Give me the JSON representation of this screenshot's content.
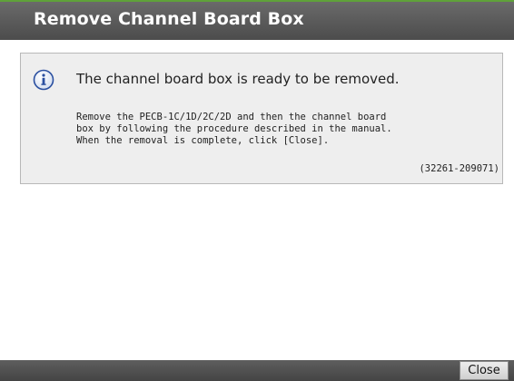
{
  "dialog": {
    "title": "Remove Channel Board Box",
    "message": {
      "icon": "info-icon",
      "headline": "The channel board box is ready to be removed.",
      "detail_lines": [
        "Remove the PECB-1C/1D/2C/2D and then the channel board",
        "box by following the procedure described in the manual.",
        "When the removal is complete, click [Close]."
      ],
      "code": "(32261-209071)"
    },
    "footer": {
      "close_label": "Close"
    }
  },
  "colors": {
    "titlebar": "#595959",
    "accent_top": "#5fa23a",
    "message_bg": "#eeeeee",
    "info_blue": "#2a4fa0"
  }
}
